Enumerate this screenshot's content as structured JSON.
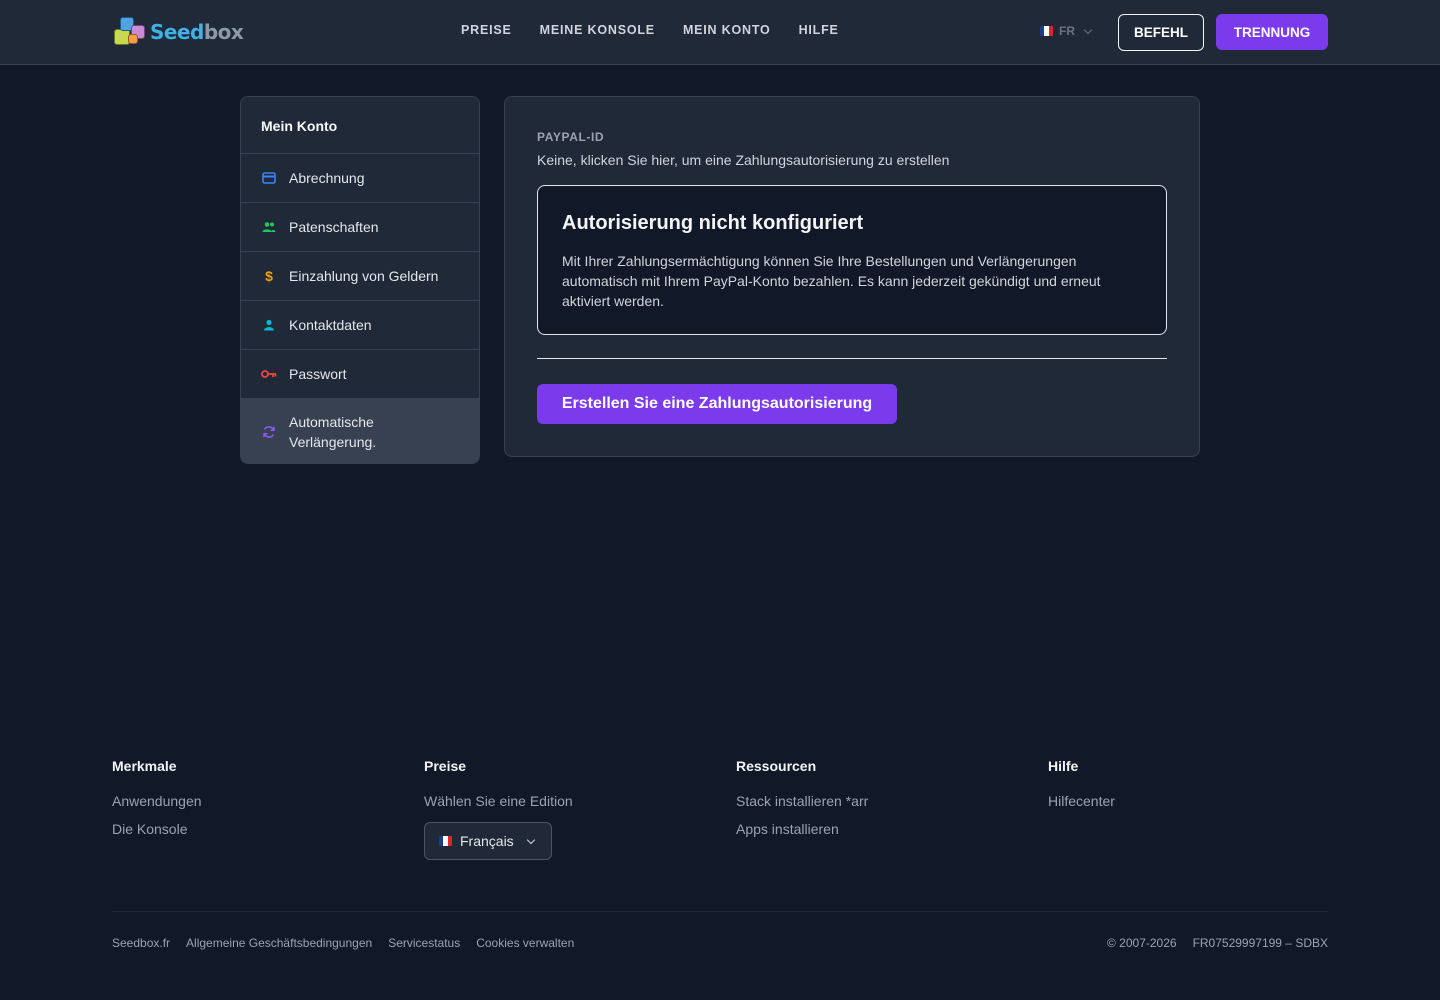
{
  "header": {
    "logo_text_a": "Seed",
    "logo_text_b": "box",
    "nav": [
      "PREISE",
      "MEINE KONSOLE",
      "MEIN KONTO",
      "HILFE"
    ],
    "lang_code": "FR",
    "order_label": "BEFEHL",
    "logout_label": "TRENNUNG"
  },
  "sidebar": {
    "title": "Mein Konto",
    "items": [
      {
        "label": "Abrechnung",
        "icon": "credit-card-icon",
        "color": "#3b82f6"
      },
      {
        "label": "Patenschaften",
        "icon": "users-icon",
        "color": "#22c55e"
      },
      {
        "label": "Einzahlung von Geldern",
        "icon": "dollar-icon",
        "color": "#f59e0b"
      },
      {
        "label": "Kontaktdaten",
        "icon": "user-icon",
        "color": "#06b6d4"
      },
      {
        "label": "Passwort",
        "icon": "key-icon",
        "color": "#ef4444"
      },
      {
        "label": "Automatische Verlängerung.",
        "icon": "refresh-icon",
        "color": "#8b5cf6",
        "active": true
      }
    ]
  },
  "main": {
    "paypal_label": "PAYPAL-ID",
    "paypal_value": "Keine, klicken Sie hier, um eine Zahlungsautorisierung zu erstellen",
    "box_title": "Autorisierung nicht konfiguriert",
    "box_text": "Mit Ihrer Zahlungsermächtigung können Sie Ihre Bestellungen und Verlängerungen automatisch mit Ihrem PayPal-Konto bezahlen. Es kann jederzeit gekündigt und erneut aktiviert werden.",
    "create_button": "Erstellen Sie eine Zahlungsautorisierung"
  },
  "footer": {
    "columns": [
      {
        "title": "Merkmale",
        "links": [
          "Anwendungen",
          "Die Konsole"
        ]
      },
      {
        "title": "Preise",
        "links": [
          "Wählen Sie eine Edition"
        ]
      },
      {
        "title": "Ressourcen",
        "links": [
          "Stack installieren *arr",
          "Apps installieren"
        ]
      },
      {
        "title": "Hilfe",
        "links": [
          "Hilfecenter"
        ]
      }
    ],
    "language_select": "Français",
    "bottom_links": [
      "Seedbox.fr",
      "Allgemeine Geschäftsbedingungen",
      "Servicestatus",
      "Cookies verwalten"
    ],
    "copyright": "© 2007-2026",
    "company_id": "FR07529997199 – SDBX"
  }
}
